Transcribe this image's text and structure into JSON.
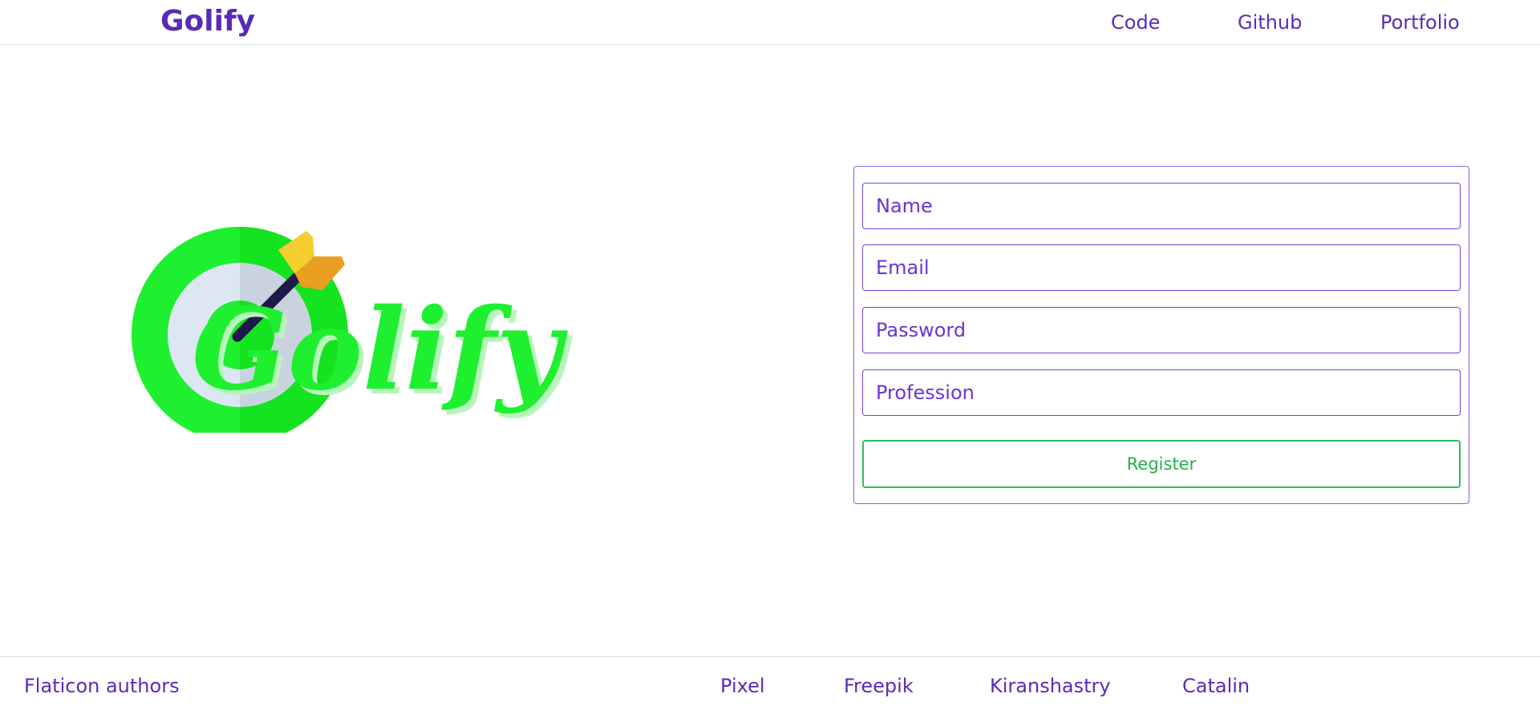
{
  "header": {
    "brand": "Golify",
    "nav": [
      {
        "label": "Code"
      },
      {
        "label": "Github"
      },
      {
        "label": "Portfolio"
      }
    ]
  },
  "hero": {
    "logo_text": "Golify",
    "icon": "target-dart-icon",
    "colors": {
      "green": "#1ef02f",
      "green_dark": "#16e31f",
      "ring_light": "#dde7f3",
      "ring_shade": "#c9d3df",
      "dart_yellow": "#f3cf2f",
      "dart_orange": "#e9a022",
      "dart_shaft": "#1e1b4b"
    }
  },
  "form": {
    "fields": [
      {
        "placeholder": "Name"
      },
      {
        "placeholder": "Email"
      },
      {
        "placeholder": "Password"
      },
      {
        "placeholder": "Profession"
      }
    ],
    "submit_label": "Register"
  },
  "footer": {
    "title": "Flaticon authors",
    "authors": [
      {
        "label": "Pixel"
      },
      {
        "label": "Freepik"
      },
      {
        "label": "Kiranshastry"
      },
      {
        "label": "Catalin"
      }
    ]
  },
  "colors": {
    "accent": "#5a2bb8",
    "border": "#8b5cf6",
    "success": "#22b04d"
  }
}
